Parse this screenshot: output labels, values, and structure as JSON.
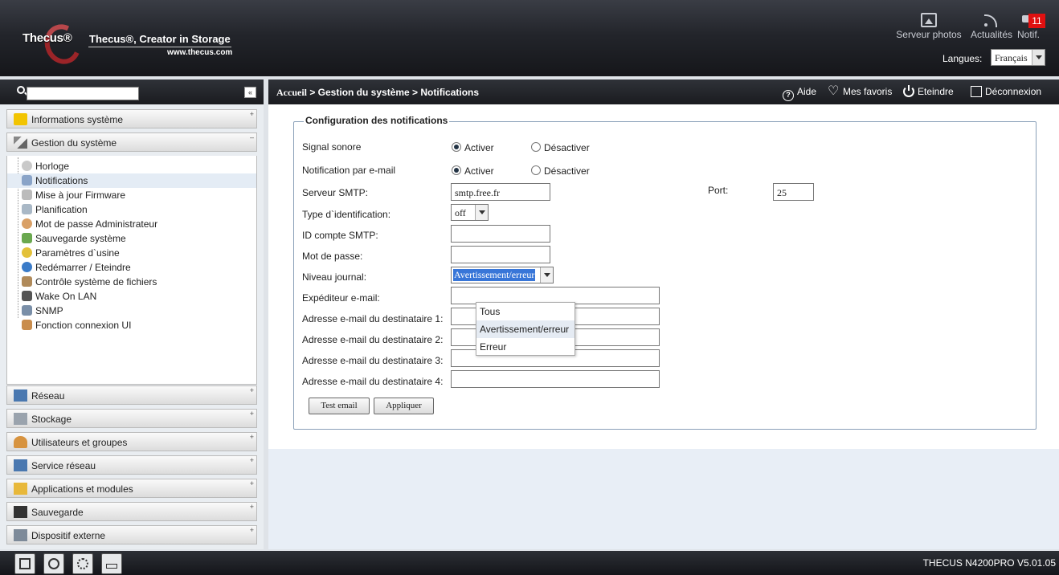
{
  "header": {
    "brand": "Thecus®",
    "tagline": "Thecus®, Creator in Storage",
    "website": "www.thecus.com",
    "buttons": [
      {
        "label": "Serveur photos",
        "icon": "photo-icon"
      },
      {
        "label": "Actualités",
        "icon": "rss-icon"
      },
      {
        "label": "Notif.",
        "icon": "notification-icon"
      }
    ],
    "notif_count": "11",
    "language_label": "Langues:",
    "language_value": "Français"
  },
  "sidebar": {
    "collapse_label": "«",
    "categories_top": [
      {
        "label": "Informations système",
        "toggle": "+",
        "icon": "info-icon"
      },
      {
        "label": "Gestion du système",
        "toggle": "–",
        "icon": "tools-icon"
      }
    ],
    "sub_items": [
      {
        "label": "Horloge",
        "icon": "clock-icon"
      },
      {
        "label": "Notifications",
        "icon": "notification-icon"
      },
      {
        "label": "Mise à jour Firmware",
        "icon": "firmware-icon"
      },
      {
        "label": "Planification",
        "icon": "schedule-icon"
      },
      {
        "label": "Mot de passe Administrateur",
        "icon": "admin-icon"
      },
      {
        "label": "Sauvegarde système",
        "icon": "backup-icon"
      },
      {
        "label": "Paramètres d`usine",
        "icon": "reset-icon"
      },
      {
        "label": "Redémarrer / Eteindre",
        "icon": "restart-icon"
      },
      {
        "label": "Contrôle système de fichiers",
        "icon": "filesystem-icon"
      },
      {
        "label": "Wake On LAN",
        "icon": "wol-icon"
      },
      {
        "label": "SNMP",
        "icon": "snmp-icon"
      },
      {
        "label": "Fonction connexion UI",
        "icon": "ui-login-icon"
      }
    ],
    "categories_bottom": [
      {
        "label": "Réseau",
        "toggle": "+",
        "icon": "network-icon"
      },
      {
        "label": "Stockage",
        "toggle": "+",
        "icon": "storage-icon"
      },
      {
        "label": "Utilisateurs et groupes",
        "toggle": "+",
        "icon": "users-icon"
      },
      {
        "label": "Service réseau",
        "toggle": "+",
        "icon": "network-service-icon"
      },
      {
        "label": "Applications et modules",
        "toggle": "+",
        "icon": "apps-icon"
      },
      {
        "label": "Sauvegarde",
        "toggle": "+",
        "icon": "backup-icon"
      },
      {
        "label": "Dispositif externe",
        "toggle": "+",
        "icon": "external-device-icon"
      }
    ]
  },
  "breadcrumb": {
    "home": "Accueil",
    "path": " > Gestion du système > Notifications"
  },
  "toolbar": {
    "help": "Aide",
    "favorites": "Mes favoris",
    "shutdown": "Eteindre",
    "logout": "Déconnexion"
  },
  "form": {
    "legend": "Configuration des notifications",
    "sound_label": "Signal sonore",
    "email_notif_label": "Notification par e-mail",
    "enable": "Activer",
    "disable": "Désactiver",
    "smtp_server_label": "Serveur SMTP:",
    "smtp_server_value": "smtp.free.fr",
    "port_label": "Port:",
    "port_value": "25",
    "auth_type_label": "Type d`identification:",
    "auth_type_value": "off",
    "smtp_account_label": "ID compte SMTP:",
    "password_label": "Mot de passe:",
    "log_level_label": "Niveau journal:",
    "log_level_value": "Avertissement/erreur",
    "log_level_options": [
      "Tous",
      "Avertissement/erreur",
      "Erreur"
    ],
    "sender_label": "Expéditeur e-mail:",
    "recipients": [
      "Adresse e-mail du destinataire 1:",
      "Adresse e-mail du destinataire 2:",
      "Adresse e-mail du destinataire 3:",
      "Adresse e-mail du destinataire 4:"
    ],
    "test_button": "Test email",
    "apply_button": "Appliquer"
  },
  "footer": {
    "version": "THECUS N4200PRO V5.01.05",
    "icons": [
      "server-icon",
      "disk-icon",
      "fan-icon",
      "network-icon"
    ]
  }
}
